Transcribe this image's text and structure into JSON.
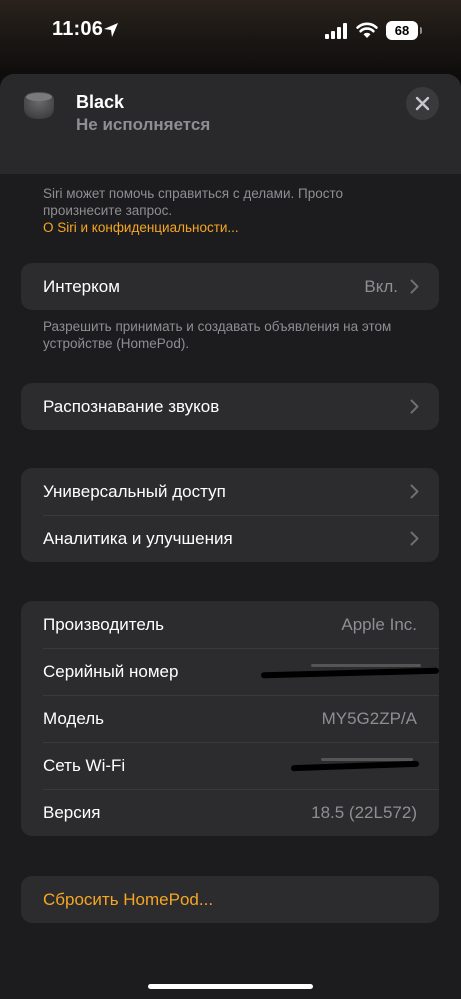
{
  "status_bar": {
    "time": "11:06",
    "battery": "68"
  },
  "header": {
    "device_name": "Black",
    "device_status": "Не исполняется"
  },
  "siri_footer": {
    "text": "Siri может помочь справиться с делами. Просто произнесите запрос.",
    "link": "О Siri и конфиденциальности..."
  },
  "intercom": {
    "label": "Интерком",
    "value": "Вкл.",
    "footer": "Разрешить принимать и создавать объявления на этом устройстве (HomePod)."
  },
  "sound_recognition": {
    "label": "Распознавание звуков"
  },
  "general": {
    "items": [
      {
        "label": "Универсальный доступ"
      },
      {
        "label": "Аналитика и улучшения"
      }
    ]
  },
  "info": {
    "rows": [
      {
        "label": "Производитель",
        "value": "Apple Inc."
      },
      {
        "label": "Серийный номер",
        "value": ""
      },
      {
        "label": "Модель",
        "value": "MY5G2ZP/A"
      },
      {
        "label": "Сеть Wi-Fi",
        "value": ""
      },
      {
        "label": "Версия",
        "value": "18.5 (22L572)"
      }
    ]
  },
  "reset": {
    "label": "Сбросить HomePod..."
  },
  "colors": {
    "accent": "#f5a623",
    "background": "#1c1c1e",
    "cell": "#2c2c2e",
    "secondary_text": "#8e8e93"
  }
}
